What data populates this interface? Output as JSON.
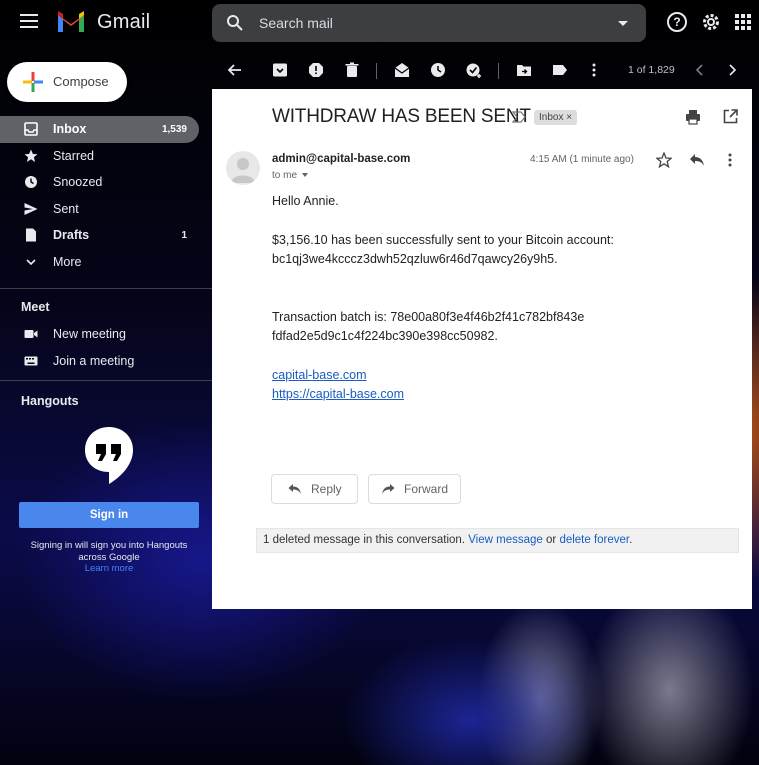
{
  "app": {
    "name": "Gmail"
  },
  "search": {
    "placeholder": "Search mail"
  },
  "compose": {
    "label": "Compose"
  },
  "sidebar": {
    "items": [
      {
        "label": "Inbox",
        "count": "1,539"
      },
      {
        "label": "Starred",
        "count": ""
      },
      {
        "label": "Snoozed",
        "count": ""
      },
      {
        "label": "Sent",
        "count": ""
      },
      {
        "label": "Drafts",
        "count": "1"
      },
      {
        "label": "More",
        "count": ""
      }
    ],
    "meet": {
      "title": "Meet",
      "new_meeting": "New meeting",
      "join_meeting": "Join a meeting"
    },
    "hangouts": {
      "title": "Hangouts",
      "signin": "Sign in",
      "note": "Signing in will sign you into Hangouts across Google",
      "learn_more": "Learn more"
    }
  },
  "toolbar": {
    "pager": "1 of 1,829"
  },
  "email": {
    "subject": "WITHDRAW HAS BEEN SENT",
    "label": "Inbox",
    "label_close": "×",
    "sender": "admin@capital-base.com",
    "to": "to me",
    "time": "4:15 AM (1 minute ago)",
    "greeting": "Hello Annie.",
    "line1": "$3,156.10 has been successfully sent to your Bitcoin account:",
    "line2": "bc1qj3we4kcccz3dwh52qzluw6r46d7qawcy26y9h5.",
    "batch1": "Transaction batch is: 78e00a80f3e4f46b2f41c782bf843e",
    "batch2": "fdfad2e5d9c1c4f224bc390e398cc50982.",
    "link1": "capital-base.com",
    "link2": "https://capital-base.com",
    "reply": "Reply",
    "forward": "Forward",
    "deleted_text": "1 deleted message in this conversation.",
    "view_message": "View message",
    "or": "or",
    "delete_forever": "delete forever",
    "period": "."
  },
  "colors": {
    "accent": "#4a87ec",
    "link": "#1a5bc4",
    "active_nav": "#5f6368"
  }
}
